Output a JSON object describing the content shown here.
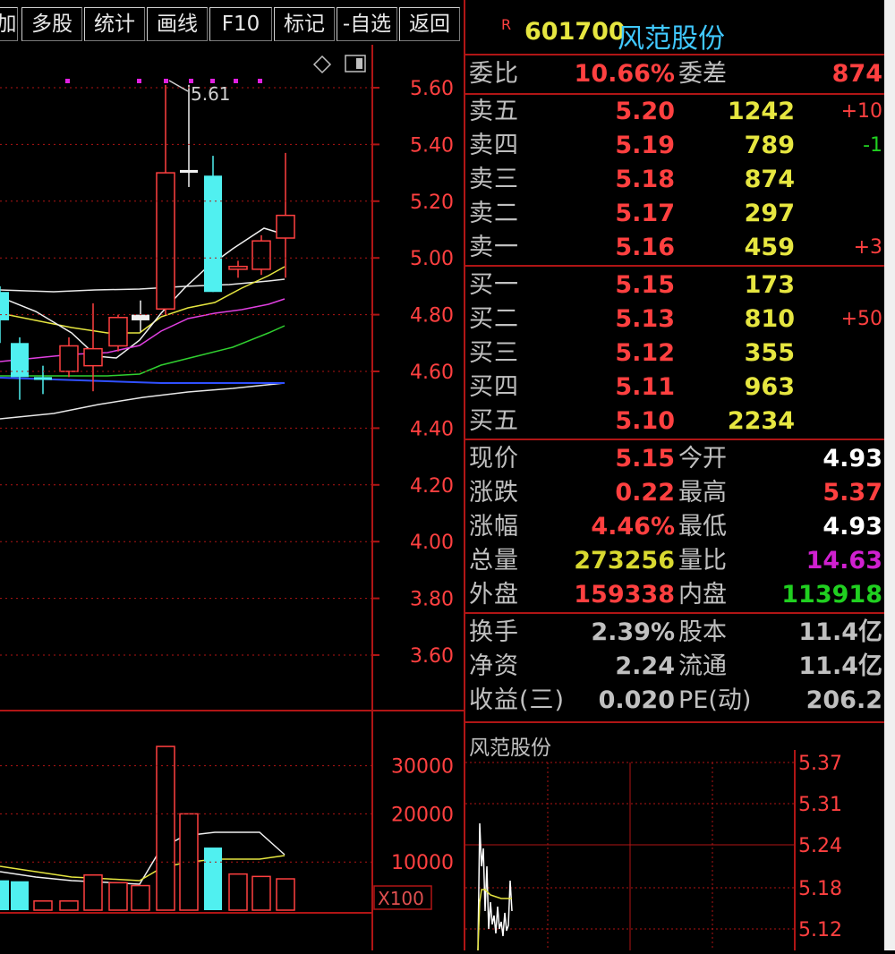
{
  "toolbar": {
    "items": [
      "加",
      "多股",
      "统计",
      "画线",
      "F10",
      "标记",
      "-自选",
      "返回"
    ]
  },
  "header": {
    "badge": "R",
    "code": "601700",
    "name": "风范股份"
  },
  "wei": {
    "wb_label": "委比",
    "wb_value": "10.66%",
    "wc_label": "委差",
    "wc_value": "874"
  },
  "sell": [
    {
      "label": "卖五",
      "price": "5.20",
      "vol": "1242",
      "chg": "+10",
      "chg_color": "#ff4040"
    },
    {
      "label": "卖四",
      "price": "5.19",
      "vol": "789",
      "chg": "-1",
      "chg_color": "#20d020"
    },
    {
      "label": "卖三",
      "price": "5.18",
      "vol": "874",
      "chg": "",
      "chg_color": "#ff4040"
    },
    {
      "label": "卖二",
      "price": "5.17",
      "vol": "297",
      "chg": "",
      "chg_color": "#ff4040"
    },
    {
      "label": "卖一",
      "price": "5.16",
      "vol": "459",
      "chg": "+3",
      "chg_color": "#ff4040"
    }
  ],
  "buy": [
    {
      "label": "买一",
      "price": "5.15",
      "vol": "173",
      "chg": "",
      "chg_color": "#ff4040"
    },
    {
      "label": "买二",
      "price": "5.13",
      "vol": "810",
      "chg": "+50",
      "chg_color": "#ff4040"
    },
    {
      "label": "买三",
      "price": "5.12",
      "vol": "355",
      "chg": "",
      "chg_color": "#ff4040"
    },
    {
      "label": "买四",
      "price": "5.11",
      "vol": "963",
      "chg": "",
      "chg_color": "#ff4040"
    },
    {
      "label": "买五",
      "price": "5.10",
      "vol": "2234",
      "chg": "",
      "chg_color": "#ff4040"
    }
  ],
  "quote": [
    {
      "l1": "现价",
      "v1": "5.15",
      "c1": "#ff4040",
      "l2": "今开",
      "v2": "4.93",
      "c2": "#ffffff"
    },
    {
      "l1": "涨跌",
      "v1": "0.22",
      "c1": "#ff4040",
      "l2": "最高",
      "v2": "5.37",
      "c2": "#ff4040"
    },
    {
      "l1": "涨幅",
      "v1": "4.46%",
      "c1": "#ff4040",
      "l2": "最低",
      "v2": "4.93",
      "c2": "#ffffff"
    },
    {
      "l1": "总量",
      "v1": "273256",
      "c1": "#d8d830",
      "l2": "量比",
      "v2": "14.63",
      "c2": "#d020d0"
    },
    {
      "l1": "外盘",
      "v1": "159338",
      "c1": "#ff4040",
      "l2": "内盘",
      "v2": "113918",
      "c2": "#20d020"
    }
  ],
  "fund": [
    {
      "l1": "换手",
      "v1": "2.39%",
      "l2": "股本",
      "v2": "11.4亿"
    },
    {
      "l1": "净资",
      "v1": "2.24",
      "l2": "流通",
      "v2": "11.4亿"
    },
    {
      "l1": "收益(三)",
      "v1": "0.020",
      "l2": "PE(动)",
      "v2": "206.2"
    }
  ],
  "mini": {
    "title": "风范股份",
    "ticks": [
      "5.37",
      "5.31",
      "5.24",
      "5.18",
      "5.12"
    ]
  },
  "kchart": {
    "price_ticks": [
      "5.60",
      "5.40",
      "5.20",
      "5.00",
      "4.80",
      "4.60",
      "4.40",
      "4.20",
      "4.00",
      "3.80",
      "3.60"
    ],
    "price_values": [
      5.6,
      5.4,
      5.2,
      5.0,
      4.8,
      4.6,
      4.4,
      4.2,
      4.0,
      3.8,
      3.6
    ],
    "high_label": "5.61",
    "vol_ticks": [
      "30000",
      "20000",
      "10000"
    ],
    "vol_values": [
      30000,
      20000,
      10000
    ],
    "vol_unit": "X100"
  },
  "chart_data": {
    "type": "candlestick",
    "ylim": [
      3.5,
      5.7
    ],
    "candles": [
      {
        "o": 4.88,
        "c": 4.78,
        "h": 4.9,
        "l": 4.7,
        "color": "cyan"
      },
      {
        "o": 4.58,
        "c": 4.7,
        "h": 4.72,
        "l": 4.5,
        "color": "cyan"
      },
      {
        "o": 4.57,
        "c": 4.58,
        "h": 4.62,
        "l": 4.52,
        "color": "cyan"
      },
      {
        "o": 4.6,
        "c": 4.69,
        "h": 4.72,
        "l": 4.58,
        "color": "red"
      },
      {
        "o": 4.62,
        "c": 4.68,
        "h": 4.84,
        "l": 4.53,
        "color": "red"
      },
      {
        "o": 4.69,
        "c": 4.79,
        "h": 4.8,
        "l": 4.67,
        "color": "red"
      },
      {
        "o": 4.78,
        "c": 4.8,
        "h": 4.85,
        "l": 4.74,
        "color": "white"
      },
      {
        "o": 4.82,
        "c": 5.3,
        "h": 5.61,
        "l": 4.8,
        "color": "red"
      },
      {
        "o": 5.31,
        "c": 5.3,
        "h": 5.61,
        "l": 5.25,
        "color": "white"
      },
      {
        "o": 5.29,
        "c": 4.88,
        "h": 5.36,
        "l": 4.88,
        "color": "cyan"
      },
      {
        "o": 4.96,
        "c": 4.97,
        "h": 4.99,
        "l": 4.93,
        "color": "red"
      },
      {
        "o": 4.96,
        "c": 5.06,
        "h": 5.08,
        "l": 4.94,
        "color": "red"
      },
      {
        "o": 5.07,
        "c": 5.15,
        "h": 5.37,
        "l": 4.93,
        "color": "red"
      }
    ],
    "volumes": [
      {
        "v": 6200,
        "color": "cyan"
      },
      {
        "v": 6000,
        "color": "cyan"
      },
      {
        "v": 1900,
        "color": "red"
      },
      {
        "v": 1900,
        "color": "red"
      },
      {
        "v": 7300,
        "color": "red"
      },
      {
        "v": 5700,
        "color": "red"
      },
      {
        "v": 5100,
        "color": "red"
      },
      {
        "v": 34000,
        "color": "red"
      },
      {
        "v": 20000,
        "color": "red"
      },
      {
        "v": 13000,
        "color": "cyan"
      },
      {
        "v": 7500,
        "color": "red"
      },
      {
        "v": 7000,
        "color": "red"
      },
      {
        "v": 6500,
        "color": "red"
      }
    ]
  }
}
